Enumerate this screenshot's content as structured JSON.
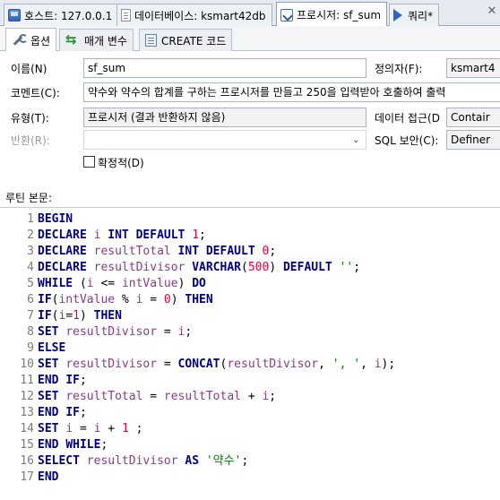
{
  "tabs": {
    "host": "호스트: 127.0.0.1",
    "database": "데이터베이스: ksmart42db",
    "procedure": "프로시저: sf_sum",
    "query": "쿼리*"
  },
  "subtabs": {
    "options": "옵션",
    "parameters": "매개 변수",
    "create_code": "CREATE 코드"
  },
  "form": {
    "name_label": "이름(N)",
    "name_value": "sf_sum",
    "definer_label": "정의자(F):",
    "definer_value": "ksmart4",
    "comment_label": "코멘트(C):",
    "comment_value": "약수와 약수의 합계를 구하는 프로시저를 만들고 250을 입력받아 호출하여 출력",
    "type_label": "유형(T):",
    "type_value": "프로시저 (결과 반환하지 않음)",
    "data_access_label": "데이터 접근(D",
    "data_access_value": "Contair",
    "return_label": "반환(R):",
    "return_value": "",
    "sql_security_label": "SQL 보안(C):",
    "sql_security_value": "Definer",
    "deterministic_label": "확정적(D)",
    "deterministic_checked": false
  },
  "routine_body_label": "루틴 본문:",
  "code_lines": [
    {
      "n": "1",
      "text": "BEGIN"
    },
    {
      "n": "2",
      "text": "DECLARE i INT DEFAULT 1;"
    },
    {
      "n": "3",
      "text": "DECLARE resultTotal INT DEFAULT 0;"
    },
    {
      "n": "4",
      "text": "DECLARE resultDivisor VARCHAR(500) DEFAULT '';"
    },
    {
      "n": "5",
      "text": "WHILE (i <= intValue) DO"
    },
    {
      "n": "6",
      "text": "IF(intValue % i = 0) THEN"
    },
    {
      "n": "7",
      "text": "IF(i=1) THEN"
    },
    {
      "n": "8",
      "text": "SET resultDivisor = i;"
    },
    {
      "n": "9",
      "text": "ELSE"
    },
    {
      "n": "10",
      "text": "SET resultDivisor = CONCAT(resultDivisor, ', ', i);"
    },
    {
      "n": "11",
      "text": "END IF;"
    },
    {
      "n": "12",
      "text": "SET resultTotal = resultTotal + i;"
    },
    {
      "n": "13",
      "text": "END IF;"
    },
    {
      "n": "14",
      "text": "SET i = i + 1 ;"
    },
    {
      "n": "15",
      "text": "END WHILE;"
    },
    {
      "n": "16",
      "text": "SELECT resultDivisor AS '약수';"
    },
    {
      "n": "17",
      "text": "END"
    }
  ]
}
